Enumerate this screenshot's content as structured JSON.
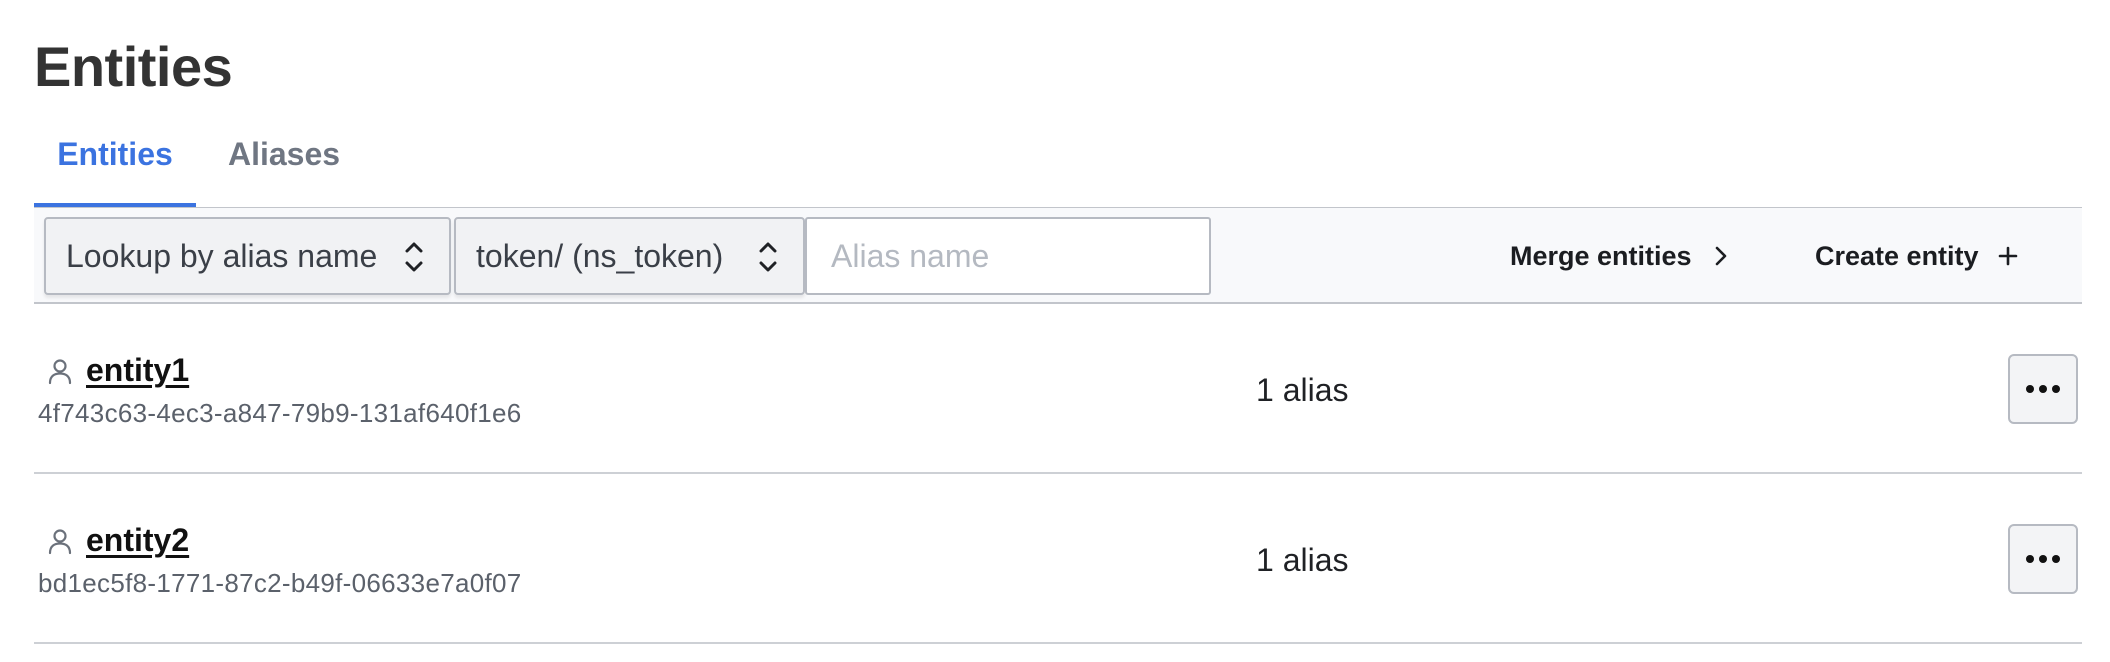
{
  "page": {
    "title": "Entities"
  },
  "tabs": [
    {
      "label": "Entities",
      "active": true
    },
    {
      "label": "Aliases",
      "active": false
    }
  ],
  "toolbar": {
    "lookup_select": {
      "value": "Lookup by alias name",
      "icon": "chevron-up-down-icon"
    },
    "mount_select": {
      "value": "token/ (ns_token)",
      "icon": "chevron-up-down-icon"
    },
    "search": {
      "placeholder": "Alias name",
      "value": ""
    },
    "merge_label": "Merge entities",
    "create_label": "Create entity"
  },
  "entities": [
    {
      "name": "entity1",
      "id": "4f743c63-4ec3-a847-79b9-131af640f1e6",
      "aliases": "1 alias",
      "icon": "person-icon"
    },
    {
      "name": "entity2",
      "id": "bd1ec5f8-1771-87c2-b49f-06633e7a0f07",
      "aliases": "1 alias",
      "icon": "person-icon"
    }
  ],
  "colors": {
    "accent": "#3b73e0",
    "border": "#c2c5cb",
    "toolbar_bg": "#f8f9fb"
  }
}
